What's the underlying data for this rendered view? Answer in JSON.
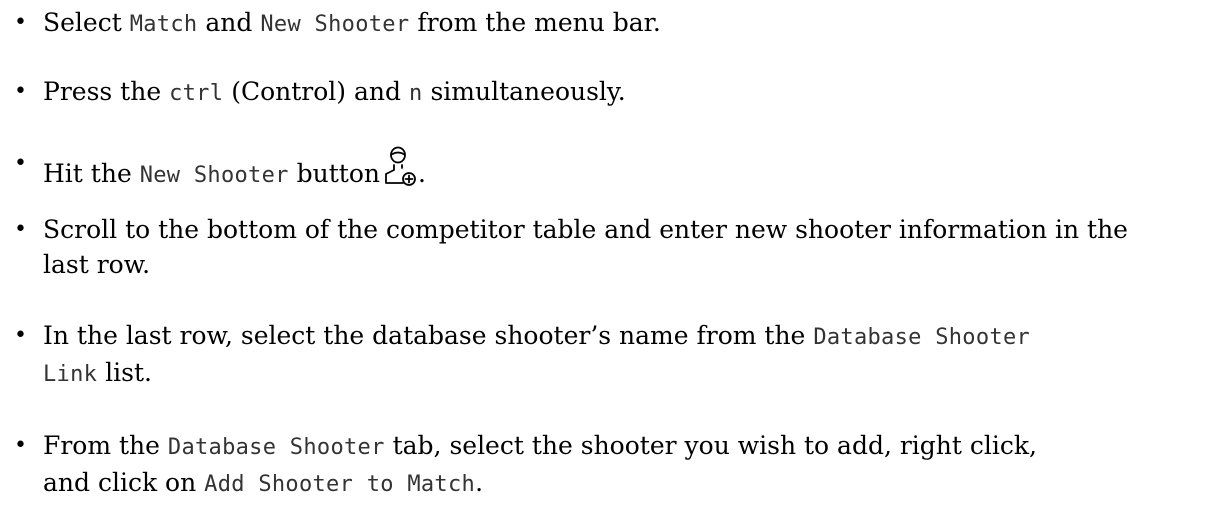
{
  "items": [
    {
      "t1": "Select",
      "c1": "Match",
      "t2": "and",
      "c2": "New Shooter",
      "t3": "from the menu bar."
    },
    {
      "t1": "Press the",
      "c1": "ctrl",
      "t2": "(Control) and",
      "c2": "n",
      "t3": "simultaneously."
    },
    {
      "t1": "Hit the",
      "c1": "New Shooter",
      "t2": "button",
      "icon": "new-shooter-icon",
      "t3": "."
    },
    {
      "line1": "Scroll to the bottom of the competitor table and enter new shooter information in the",
      "line2": "last row."
    },
    {
      "t1": "In the last row, select the database shooter’s name from the",
      "c1a": "Database Shooter",
      "c1b": "Link",
      "t2": "list."
    },
    {
      "t1": "From the",
      "c1": "Database Shooter",
      "t2": "tab, select the shooter you wish to add, right click,",
      "t3": "and click on",
      "c2": "Add Shooter to Match",
      "t4": "."
    }
  ]
}
